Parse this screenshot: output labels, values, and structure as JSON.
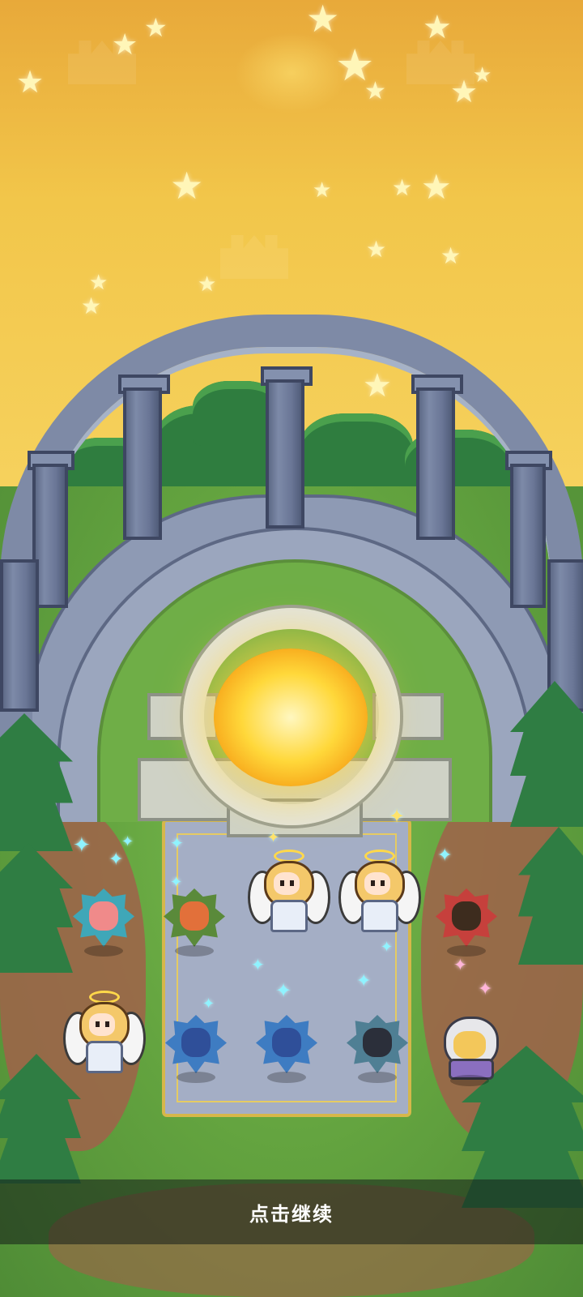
{
  "screen": {
    "prompt": "点击继续"
  },
  "scene": {
    "sky_color": "#f2c64a",
    "grass_color": "#63a33f",
    "portal_color": "#ffd83a"
  },
  "heroes_row1": [
    {
      "type": "flower",
      "color": "#3fa7b8",
      "face": "#f08a8a"
    },
    {
      "type": "flower",
      "color": "#5a8a3a",
      "face": "#e2703a"
    },
    {
      "type": "angel"
    },
    {
      "type": "angel"
    },
    {
      "type": "flower",
      "color": "#c6403c",
      "face": "#3d2c1e"
    }
  ],
  "heroes_row2": [
    {
      "type": "angel"
    },
    {
      "type": "flower",
      "color": "#3e7cc2",
      "face": "#2f4f99"
    },
    {
      "type": "flower",
      "color": "#3e7cc2",
      "face": "#2f4f99"
    },
    {
      "type": "flower",
      "color": "#4f7f94",
      "face": "#2b2f3a"
    },
    {
      "type": "knight"
    }
  ]
}
